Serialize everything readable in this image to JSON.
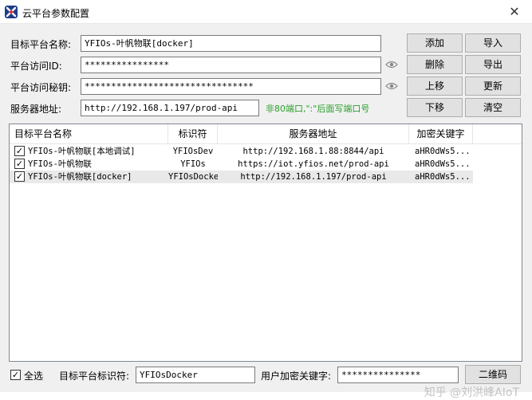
{
  "window": {
    "title": "云平台参数配置",
    "close_symbol": "✕"
  },
  "form": {
    "name_label": "目标平台名称:",
    "name_value": "YFIOs-叶帆物联[docker]",
    "id_label": "平台访问ID:",
    "id_value": "****************",
    "secret_label": "平台访问秘钥:",
    "secret_value": "********************************",
    "server_label": "服务器地址:",
    "server_value": "http://192.168.1.197/prod-api",
    "hint": "非80端口,\":\"后面写端口号"
  },
  "buttons": {
    "add": "添加",
    "import": "导入",
    "delete": "删除",
    "export": "导出",
    "up": "上移",
    "update": "更新",
    "down": "下移",
    "clear": "清空",
    "qrcode": "二维码"
  },
  "table": {
    "columns": [
      "目标平台名称",
      "标识符",
      "服务器地址",
      "加密关键字"
    ],
    "rows": [
      {
        "checked": true,
        "name": "YFIOs-叶帆物联[本地调试]",
        "id": "YFIOsDev",
        "server": "http://192.168.1.88:8844/api",
        "key": "aHR0dWs5..."
      },
      {
        "checked": true,
        "name": "YFIOs-叶帆物联",
        "id": "YFIOs",
        "server": "https://iot.yfios.net/prod-api",
        "key": "aHR0dWs5..."
      },
      {
        "checked": true,
        "name": "YFIOs-叶帆物联[docker]",
        "id": "YFIOsDocker",
        "server": "http://192.168.1.197/prod-api",
        "key": "aHR0dWs5..."
      }
    ]
  },
  "footer": {
    "select_all_label": "全选",
    "select_all_checked": true,
    "platform_id_label": "目标平台标识符:",
    "platform_id_value": "YFIOsDocker",
    "user_key_label": "用户加密关键字:",
    "user_key_value": "***************"
  },
  "watermark": "知乎 @刘洪峰AIoT"
}
